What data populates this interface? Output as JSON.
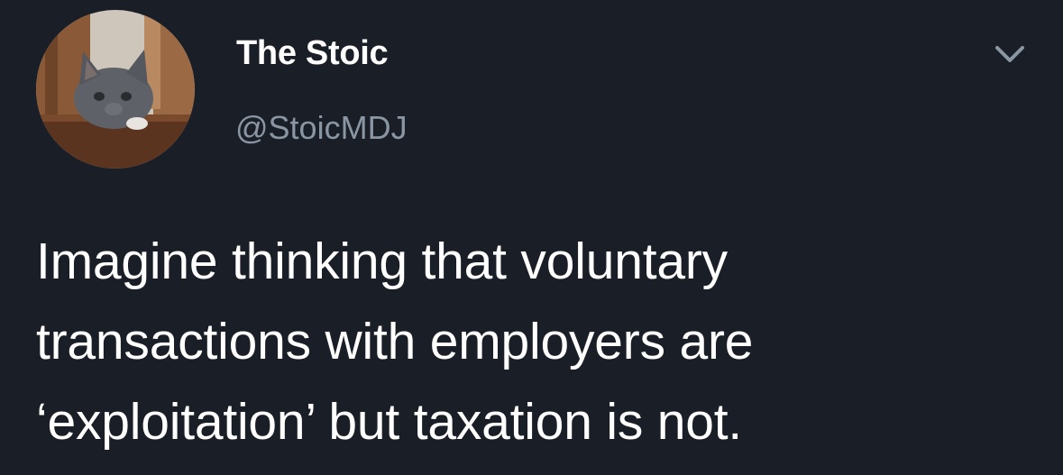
{
  "author": {
    "display_name": "The Stoic",
    "handle": "@StoicMDJ",
    "avatar_icon": "cat-photo-avatar"
  },
  "menu": {
    "icon": "chevron-down-icon"
  },
  "tweet": {
    "text_lines": [
      "Imagine thinking that voluntary",
      "transactions with employers are",
      "‘exploitation’ but taxation is not."
    ]
  },
  "colors": {
    "background": "#1a1e26",
    "text": "#ffffff",
    "secondary_text": "#8a96a3"
  }
}
